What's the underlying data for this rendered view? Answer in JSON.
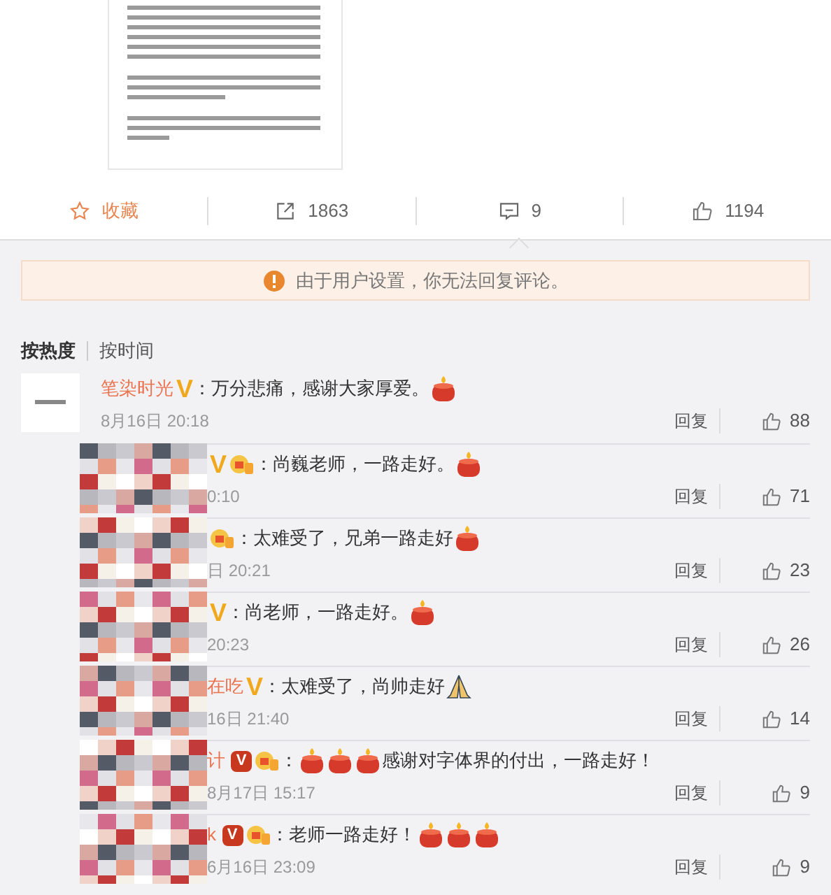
{
  "actions": [
    {
      "kind": "favorite",
      "label": "收藏",
      "selected": false
    },
    {
      "kind": "repost",
      "label": "1863",
      "selected": false
    },
    {
      "kind": "comment",
      "label": "9",
      "selected": true
    },
    {
      "kind": "like",
      "label": "1194",
      "selected": false
    }
  ],
  "notice": "由于用户设置，你无法回复评论。",
  "sort_tabs": [
    {
      "label": "按热度",
      "selected": true
    },
    {
      "label": "按时间",
      "selected": false
    }
  ],
  "comments": [
    {
      "pixelated": false,
      "name": "笔染时光",
      "badge": {
        "kind": "gold",
        "text": "V"
      },
      "medal": false,
      "content": [
        {
          "kind": "text",
          "text": "：万分悲痛，感谢大家厚爱。"
        },
        {
          "kind": "candle"
        }
      ],
      "time": "8月16日 20:18",
      "reply": "回复",
      "likes": "88"
    },
    {
      "pixelated": true,
      "badge": {
        "kind": "gold",
        "text": "V"
      },
      "medal": true,
      "content": [
        {
          "kind": "text",
          "text": "：尚巍老师，一路走好。"
        },
        {
          "kind": "candle"
        }
      ],
      "time": "0:10",
      "reply": "回复",
      "likes": "71"
    },
    {
      "pixelated": true,
      "medal": true,
      "content": [
        {
          "kind": "text",
          "text": "：太难受了，兄弟一路走好"
        },
        {
          "kind": "candle"
        }
      ],
      "time": "日 20:21",
      "reply": "回复",
      "likes": "23"
    },
    {
      "pixelated": true,
      "badge": {
        "kind": "gold",
        "text": "V"
      },
      "medal": false,
      "content": [
        {
          "kind": "text",
          "text": "：尚老师，一路走好。"
        },
        {
          "kind": "candle"
        }
      ],
      "time": "20:23",
      "reply": "回复",
      "likes": "26"
    },
    {
      "pixelated": true,
      "name": "在吃",
      "badge": {
        "kind": "gold",
        "text": "V"
      },
      "medal": false,
      "content": [
        {
          "kind": "text",
          "text": "：太难受了，尚帅走好"
        },
        {
          "kind": "pray"
        }
      ],
      "time": "16日 21:40",
      "reply": "回复",
      "likes": "14"
    },
    {
      "pixelated": true,
      "name": "计",
      "badge": {
        "kind": "red",
        "text": "V"
      },
      "medal": true,
      "content": [
        {
          "kind": "text",
          "text": "："
        },
        {
          "kind": "candle"
        },
        {
          "kind": "candle"
        },
        {
          "kind": "candle"
        },
        {
          "kind": "text",
          "text": "感谢对字体界的付出，一路走好！"
        }
      ],
      "time": "8月17日 15:17",
      "reply": "回复",
      "likes": "9"
    },
    {
      "pixelated": true,
      "name": "k",
      "badge": {
        "kind": "red",
        "text": "V"
      },
      "medal": true,
      "content": [
        {
          "kind": "text",
          "text": "：老师一路走好！"
        },
        {
          "kind": "candle"
        },
        {
          "kind": "candle"
        },
        {
          "kind": "candle"
        }
      ],
      "time": "6月16日 23:09",
      "reply": "回复",
      "likes": "9"
    }
  ]
}
